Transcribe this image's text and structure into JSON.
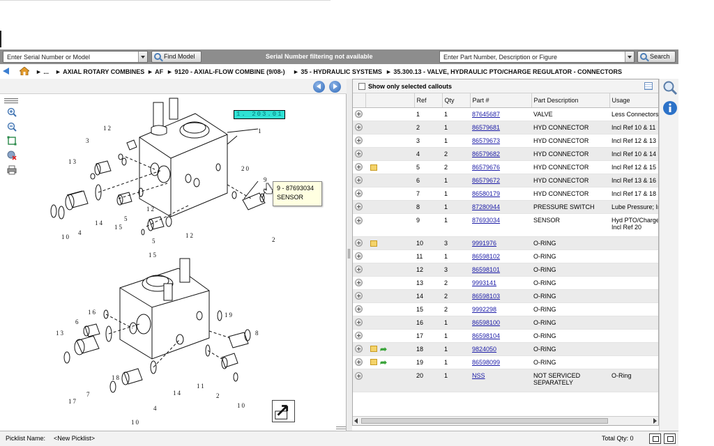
{
  "search": {
    "serial_placeholder": "Enter Serial Number or Model",
    "find_model_label": "Find Model",
    "filter_note": "Serial Number filtering not available",
    "part_placeholder": "Enter Part Number, Description or Figure",
    "search_label": "Search"
  },
  "breadcrumb": {
    "ellipsis": "...",
    "items": [
      "AXIAL ROTARY COMBINES",
      "AF",
      "9120 - AXIAL-FLOW COMBINE (9/08-)",
      "35 - HYDRAULIC SYSTEMS",
      "35.300.13 - VALVE, HYDRAULIC PTO/CHARGE REGULATOR - CONNECTORS"
    ]
  },
  "diagram": {
    "figure_code": "1. 203.01",
    "tooltip_line1": "9 - 87693034",
    "tooltip_line2": "SENSOR",
    "callouts_top": [
      "1",
      "2",
      "3",
      "4",
      "5",
      "5",
      "9",
      "10",
      "12",
      "12",
      "12",
      "13",
      "14",
      "15",
      "15",
      "20"
    ],
    "callouts_bottom": [
      "2",
      "4",
      "6",
      "7",
      "8",
      "10",
      "10",
      "11",
      "13",
      "14",
      "16",
      "17",
      "18",
      "19"
    ]
  },
  "parts_panel": {
    "show_selected_label": "Show only selected callouts",
    "columns": [
      "Ref",
      "Qty",
      "Part #",
      "Part Description",
      "Usage"
    ],
    "rows": [
      {
        "ref": "1",
        "qty": "1",
        "part": "87645687",
        "desc": "VALVE",
        "usage": "Less Connectors",
        "usage2": "",
        "note": false,
        "alt": false
      },
      {
        "ref": "2",
        "qty": "1",
        "part": "86579681",
        "desc": "HYD CONNECTOR",
        "usage": "Incl Ref 10 & 11",
        "usage2": "",
        "note": false,
        "alt": true
      },
      {
        "ref": "3",
        "qty": "1",
        "part": "86579673",
        "desc": "HYD CONNECTOR",
        "usage": "Incl Ref 12 & 13",
        "usage2": "",
        "note": false,
        "alt": false
      },
      {
        "ref": "4",
        "qty": "2",
        "part": "86579682",
        "desc": "HYD CONNECTOR",
        "usage": "Incl Ref 10 & 14",
        "usage2": "",
        "note": false,
        "alt": true
      },
      {
        "ref": "5",
        "qty": "2",
        "part": "86579676",
        "desc": "HYD CONNECTOR",
        "usage": "Incl Ref 12 & 15",
        "usage2": "",
        "note": true,
        "alt": false
      },
      {
        "ref": "6",
        "qty": "1",
        "part": "86579672",
        "desc": "HYD CONNECTOR",
        "usage": "Incl Ref 13 & 16",
        "usage2": "",
        "note": false,
        "alt": true
      },
      {
        "ref": "7",
        "qty": "1",
        "part": "86580179",
        "desc": "HYD CONNECTOR",
        "usage": "Incl Ref 17 & 18",
        "usage2": "",
        "note": false,
        "alt": false
      },
      {
        "ref": "8",
        "qty": "1",
        "part": "87280944",
        "desc": "PRESSURE SWITCH",
        "usage": "Lube Pressure; Inc",
        "usage2": "",
        "note": false,
        "alt": true
      },
      {
        "ref": "9",
        "qty": "1",
        "part": "87693034",
        "desc": "SENSOR",
        "usage": "Hyd PTO/Charge P",
        "usage2": "Incl Ref 20",
        "note": false,
        "alt": false
      },
      {
        "ref": "10",
        "qty": "3",
        "part": "9991976",
        "desc": "O-RING",
        "usage": "",
        "usage2": "",
        "note": true,
        "alt": true
      },
      {
        "ref": "11",
        "qty": "1",
        "part": "86598102",
        "desc": "O-RING",
        "usage": "",
        "usage2": "",
        "note": false,
        "alt": false
      },
      {
        "ref": "12",
        "qty": "3",
        "part": "86598101",
        "desc": "O-RING",
        "usage": "",
        "usage2": "",
        "note": false,
        "alt": true
      },
      {
        "ref": "13",
        "qty": "2",
        "part": "9993141",
        "desc": "O-RING",
        "usage": "",
        "usage2": "",
        "note": false,
        "alt": false
      },
      {
        "ref": "14",
        "qty": "2",
        "part": "86598103",
        "desc": "O-RING",
        "usage": "",
        "usage2": "",
        "note": false,
        "alt": true
      },
      {
        "ref": "15",
        "qty": "2",
        "part": "9992298",
        "desc": "O-RING",
        "usage": "",
        "usage2": "",
        "note": false,
        "alt": false
      },
      {
        "ref": "16",
        "qty": "1",
        "part": "86598100",
        "desc": "O-RING",
        "usage": "",
        "usage2": "",
        "note": false,
        "alt": true
      },
      {
        "ref": "17",
        "qty": "1",
        "part": "86598104",
        "desc": "O-RING",
        "usage": "",
        "usage2": "",
        "note": false,
        "alt": false
      },
      {
        "ref": "18",
        "qty": "1",
        "part": "9824050",
        "desc": "O-RING",
        "usage": "",
        "usage2": "",
        "note": true,
        "arrow": true,
        "alt": true
      },
      {
        "ref": "19",
        "qty": "1",
        "part": "86598099",
        "desc": "O-RING",
        "usage": "",
        "usage2": "",
        "note": true,
        "arrow": true,
        "alt": false
      },
      {
        "ref": "20",
        "qty": "1",
        "part": "NSS",
        "desc": "NOT SERVICED",
        "desc2": "SEPARATELY",
        "usage": "O-Ring",
        "usage2": "",
        "note": false,
        "alt": true
      }
    ]
  },
  "footer": {
    "picklist_label": "Picklist Name:",
    "picklist_value": "<New Picklist>",
    "total_qty": "Total Qty: 0"
  },
  "icons": {
    "back": "arrow-left-icon",
    "home": "home-icon",
    "prev": "circle-arrow-left-icon",
    "next": "circle-arrow-right-icon",
    "zoom_in": "zoom-in-icon",
    "zoom_out": "zoom-out-icon",
    "fit": "fit-to-window-icon",
    "clear": "clear-zoom-icon",
    "print": "print-icon",
    "side_search": "magnifier-icon",
    "side_info": "info-icon"
  },
  "colors": {
    "toolbar": "#8d8d8d",
    "link": "#1a1aa6",
    "callout_highlight": "#2fe1d4",
    "tooltip": "#ffffe1",
    "accent_blue": "#3c7fd1"
  }
}
